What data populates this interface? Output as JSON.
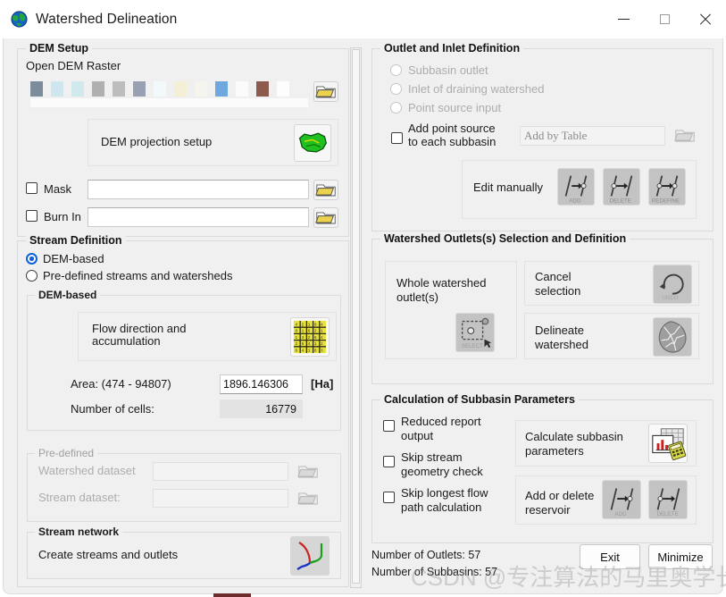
{
  "window": {
    "title": "Watershed Delineation",
    "icon": "globe-icon",
    "minimize": "minimize-icon",
    "maximize": "maximize-icon",
    "close": "close-icon"
  },
  "dem_setup": {
    "legend": "DEM Setup",
    "open_dem_raster_label": "Open DEM Raster",
    "raster_swatches": [
      "#7d8c9b",
      "#cfe6ef",
      "#cfe9ec",
      "#b0b0b0",
      "#bdbdbd",
      "#9aa0b4",
      "#f3f8fb",
      "#f5f0d5",
      "#f6f4ee",
      "#6ea8de",
      "#fbfbfb",
      "#8c5b4d",
      "#fdfdfd"
    ],
    "projection_label": "DEM projection setup",
    "projection_icon": "usa-map-icon",
    "mask": {
      "label": "Mask",
      "checked": false,
      "value": ""
    },
    "burn_in": {
      "label": "Burn In",
      "checked": false,
      "value": ""
    },
    "folder_icon": "folder-icon"
  },
  "stream_definition": {
    "legend": "Stream Definition",
    "options": [
      {
        "label": "DEM-based",
        "selected": true
      },
      {
        "label": "Pre-defined streams and watersheds",
        "selected": false
      }
    ],
    "dem_based": {
      "legend": "DEM-based",
      "flow_label": "Flow direction and\naccumulation",
      "flow_icon": "grid-flow-icon",
      "area_label": "Area: (474 - 94807)",
      "area_value": "1896.146306",
      "area_unit": "[Ha]",
      "cells_label": "Number of cells:",
      "cells_value": "16779"
    },
    "predefined": {
      "legend": "Pre-defined",
      "watershed_label": "Watershed dataset",
      "watershed_value": "",
      "stream_label": "Stream dataset:",
      "stream_value": ""
    },
    "stream_network": {
      "legend": "Stream network",
      "label": "Create streams and outlets",
      "icon": "stream-network-icon"
    }
  },
  "outlet_inlet": {
    "legend": "Outlet and Inlet Definition",
    "radios": [
      {
        "label": "Subbasin outlet",
        "selected": false
      },
      {
        "label": "Inlet of draining watershed",
        "selected": false
      },
      {
        "label": "Point source input",
        "selected": false
      }
    ],
    "add_point_source": {
      "label": "Add point source\nto each subbasin",
      "checked": false
    },
    "add_by_table_placeholder": "Add by Table",
    "add_by_table_value": "",
    "edit_manually_label": "Edit manually",
    "edit_buttons": [
      {
        "caption": "ADD",
        "icon": "add-outlet-icon"
      },
      {
        "caption": "DELETE",
        "icon": "delete-outlet-icon"
      },
      {
        "caption": "REDEFINE",
        "icon": "redefine-outlet-icon"
      }
    ]
  },
  "watershed_outlets": {
    "legend": "Watershed Outlets(s) Selection and Definition",
    "whole_watershed_label": "Whole watershed\noutlet(s)",
    "whole_watershed_caption": "SELECT",
    "whole_watershed_icon": "select-box-icon",
    "cancel_label": "Cancel\nselection",
    "cancel_caption": "UNDO",
    "cancel_icon": "undo-icon",
    "delineate_label": "Delineate\nwatershed",
    "delineate_icon": "watershed-icon"
  },
  "subbasin_params": {
    "legend": "Calculation of Subbasin Parameters",
    "checkboxes": [
      {
        "label": "Reduced  report\noutput",
        "checked": false
      },
      {
        "label": "Skip stream\ngeometry check",
        "checked": false
      },
      {
        "label": "Skip longest flow\npath calculation",
        "checked": false
      }
    ],
    "calculate_label": "Calculate subbasin\nparameters",
    "calculate_icon": "calculator-chart-icon",
    "reservoir_label": "Add or delete\nreservoir",
    "reservoir_buttons": [
      {
        "caption": "ADD",
        "icon": "add-reservoir-icon"
      },
      {
        "caption": "DELETE",
        "icon": "delete-reservoir-icon"
      }
    ]
  },
  "status": {
    "outlets": "Number of Outlets: 57",
    "subbasins": "Number of Subbasins: 57",
    "exit_label": "Exit",
    "minimize_label": "Minimize"
  },
  "watermark": "CSDN @专注算法的马里奥学长",
  "colors": {
    "accent": "#0d63d6",
    "window_bg": "#f0f0f0",
    "title_bg": "#ffffff"
  }
}
